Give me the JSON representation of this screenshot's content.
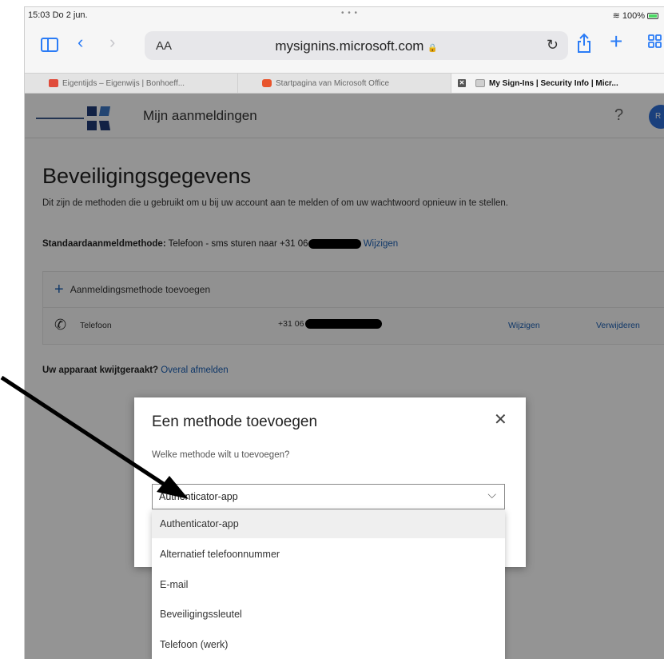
{
  "status_bar": {
    "time": "15:03  Do 2 jun.",
    "dots": "• • •",
    "battery": "100%"
  },
  "safari": {
    "aa": "AA",
    "url": "mysignins.microsoft.com",
    "lock": "🔒"
  },
  "tabs": [
    {
      "label": "Eigentijds – Eigenwijs | Bonhoeff...",
      "active": false
    },
    {
      "label": "Startpagina van Microsoft Office",
      "active": false
    },
    {
      "label": "My Sign-Ins | Security Info | Micr...",
      "active": true
    }
  ],
  "header": {
    "app_title": "Mijn aanmeldingen",
    "help": "?",
    "avatar": "R"
  },
  "security": {
    "title": "Beveiligingsgegevens",
    "description": "Dit zijn de methoden die u gebruikt om u bij uw account aan te melden of om uw wachtwoord opnieuw in te stellen.",
    "default_label": "Standaardaanmeldmethode:",
    "default_value": "Telefoon - sms sturen naar +31 06",
    "default_edit": "Wijzigen",
    "add_method": "Aanmeldingsmethode toevoegen",
    "methods": [
      {
        "label": "Telefoon",
        "number": "+31 06",
        "edit": "Wijzigen",
        "delete": "Verwijderen"
      }
    ],
    "lost_device_q": "Uw apparaat kwijtgeraakt?",
    "lost_device_link": "Overal afmelden"
  },
  "dialog": {
    "title": "Een methode toevoegen",
    "close": "✕",
    "question": "Welke methode wilt u toevoegen?",
    "selected": "Authenticator-app"
  },
  "dropdown": {
    "options": [
      "Authenticator-app",
      "Alternatief telefoonnummer",
      "E-mail",
      "Beveiligingssleutel",
      "Telefoon (werk)"
    ],
    "selected_index": 0
  },
  "colors": {
    "safari_blue": "#2b7cf6",
    "link_blue": "#1a5fb4",
    "overlay": "rgba(0,0,0,0.42)"
  }
}
